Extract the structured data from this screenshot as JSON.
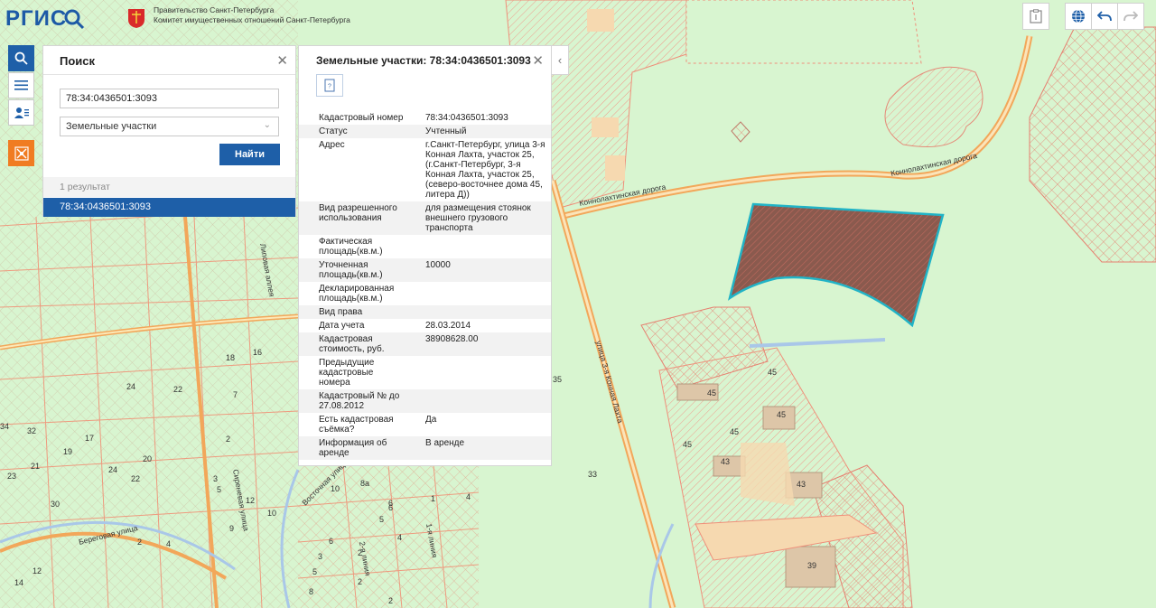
{
  "header": {
    "logo_text": "РГИС",
    "gov_line1": "Правительство Санкт-Петербурга",
    "gov_line2": "Комитет имущественных отношений Санкт-Петербурга"
  },
  "toolbar": {
    "tools": [
      "search-icon",
      "menu-icon",
      "user-list-icon",
      "city-emblem-icon"
    ]
  },
  "search": {
    "title": "Поиск",
    "query": "78:34:0436501:3093",
    "layer": "Земельные участки",
    "button": "Найти",
    "results_count": "1 результат",
    "results": [
      "78:34:0436501:3093"
    ]
  },
  "info": {
    "title": "Земельные участки: 78:34:0436501:3093",
    "rows": [
      {
        "k": "Кадастровый номер",
        "v": "78:34:0436501:3093"
      },
      {
        "k": "Статус",
        "v": "Учтенный"
      },
      {
        "k": "Адрес",
        "v": "г.Санкт-Петербург, улица 3-я Конная Лахта, участок 25, (г.Санкт-Петербург, 3-я Конная Лахта, участок 25, (северо-восточнее дома 45, литера Д))"
      },
      {
        "k": "Вид разрешенного использования",
        "v": "для размещения стоянок внешнего грузового транспорта"
      },
      {
        "k": "Фактическая площадь(кв.м.)",
        "v": ""
      },
      {
        "k": "Уточненная площадь(кв.м.)",
        "v": "10000"
      },
      {
        "k": "Декларированная площадь(кв.м.)",
        "v": ""
      },
      {
        "k": "Вид права",
        "v": ""
      },
      {
        "k": "Дата учета",
        "v": "28.03.2014"
      },
      {
        "k": "Кадастровая стоимость, руб.",
        "v": "38908628.00"
      },
      {
        "k": "Предыдущие кадастровые номера",
        "v": ""
      },
      {
        "k": "Кадастровый № до 27.08.2012",
        "v": ""
      },
      {
        "k": "Есть кадастровая съёмка?",
        "v": "Да"
      },
      {
        "k": "Информация об аренде",
        "v": "В аренде"
      }
    ]
  },
  "map": {
    "streets": [
      "Коннолахтинская дорога",
      "Коннолахтинская дорога",
      "улица 3-я Конная Лахта",
      "Липовая аллея",
      "Береговая улица",
      "Восточная улица",
      "Сиреневая улица",
      "2-я линия",
      "1-я линия"
    ],
    "numbers": [
      "45",
      "45",
      "45",
      "45",
      "45",
      "43",
      "43",
      "39",
      "35",
      "33",
      "18",
      "16",
      "24",
      "22",
      "7",
      "34",
      "32",
      "19",
      "17",
      "23",
      "21",
      "24",
      "22",
      "20",
      "2",
      "30",
      "3",
      "5",
      "12",
      "9",
      "10",
      "10",
      "8a",
      "4",
      "6",
      "5",
      "4",
      "2",
      "6",
      "3",
      "5",
      "4",
      "2",
      "12",
      "14",
      "8",
      "2",
      "1",
      "2",
      "6"
    ]
  },
  "colors": {
    "map_bg": "#d8f5d0",
    "accent": "#1e5fa8",
    "road": "#f2a75a",
    "parcel_line": "#ef8f7a",
    "selected_parcel": "#21b3c6"
  }
}
